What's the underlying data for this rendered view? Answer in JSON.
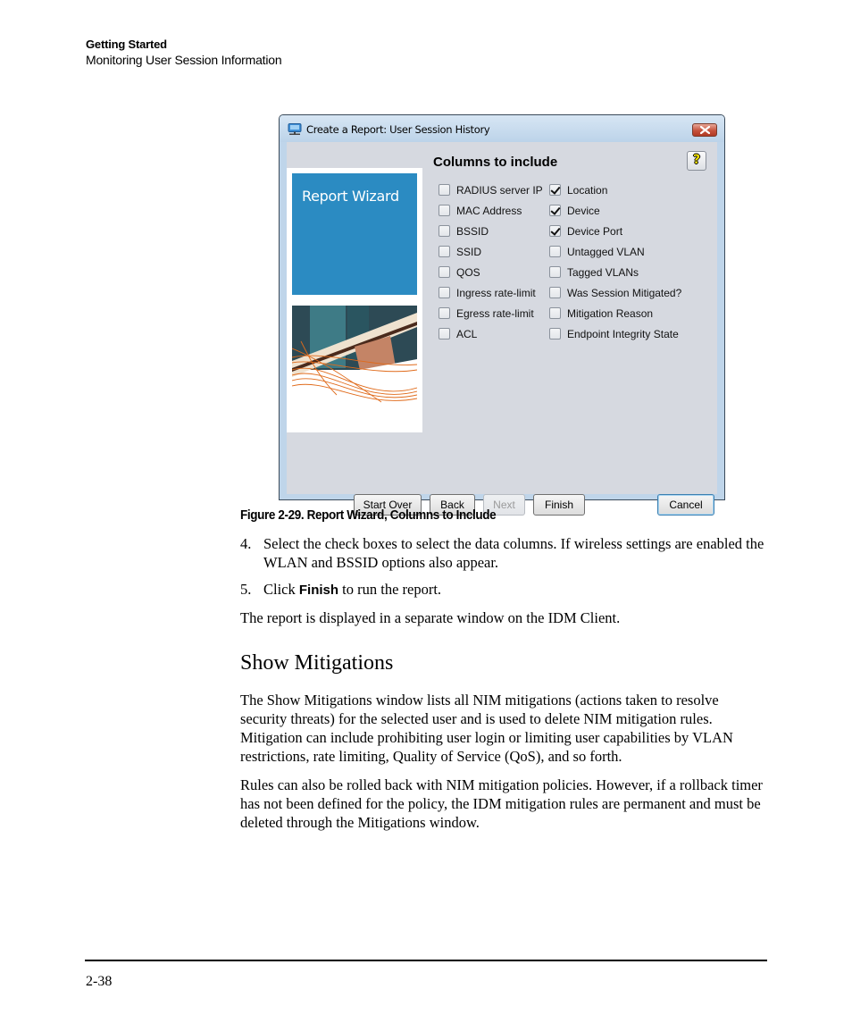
{
  "running_head": {
    "chapter": "Getting Started",
    "section": "Monitoring User Session Information"
  },
  "dialog": {
    "title": "Create a Report: User Session History",
    "title_icon": "monitor-network-icon",
    "close_icon": "close-icon",
    "side_panel": {
      "label": "Report Wizard",
      "image": "bridge-architecture-photo"
    },
    "heading": "Columns to include",
    "help_icon": "help-question-icon",
    "help_symbol": "?",
    "columns_left": [
      {
        "label": "RADIUS server IP",
        "checked": false
      },
      {
        "label": "MAC Address",
        "checked": false
      },
      {
        "label": "BSSID",
        "checked": false
      },
      {
        "label": "SSID",
        "checked": false
      },
      {
        "label": "QOS",
        "checked": false
      },
      {
        "label": "Ingress rate-limit",
        "checked": false
      },
      {
        "label": "Egress rate-limit",
        "checked": false
      },
      {
        "label": "ACL",
        "checked": false
      }
    ],
    "columns_right": [
      {
        "label": "Location",
        "checked": true
      },
      {
        "label": "Device",
        "checked": true
      },
      {
        "label": "Device Port",
        "checked": true
      },
      {
        "label": "Untagged VLAN",
        "checked": false
      },
      {
        "label": "Tagged VLANs",
        "checked": false
      },
      {
        "label": "Was Session Mitigated?",
        "checked": false
      },
      {
        "label": "Mitigation Reason",
        "checked": false
      },
      {
        "label": "Endpoint Integrity State",
        "checked": false
      }
    ],
    "buttons": {
      "start_over": "Start Over",
      "back": "Back",
      "next": "Next",
      "finish": "Finish",
      "cancel": "Cancel"
    },
    "colors": {
      "side_blue": "#2b8bc2",
      "client_bg": "#d6d9e0",
      "frame": "#bfd5ea"
    }
  },
  "figure_caption": "Figure 2-29. Report Wizard, Columns to Include",
  "steps": [
    {
      "num": "4.",
      "text": "Select the check boxes to select the data columns. If wireless settings are enabled the WLAN and BSSID options also appear."
    },
    {
      "num": "5.",
      "pre": "Click ",
      "bold": "Finish",
      "post": " to run the report."
    }
  ],
  "para1": "The report is displayed in a separate window on the IDM Client.",
  "section_heading": "Show Mitigations",
  "para2": "The Show Mitigations window lists all NIM mitigations (actions taken to resolve security threats) for the selected user and is used to delete NIM mitigation rules. Mitigation can include prohibiting user login or limiting user capabilities by VLAN restrictions, rate limiting, Quality of Service (QoS), and so forth.",
  "para3": "Rules can also be rolled back with NIM mitigation policies. However, if a rollback timer has not been defined for the policy, the IDM mitigation rules are permanent and must be deleted through the Mitigations window.",
  "page_number": "2-38"
}
